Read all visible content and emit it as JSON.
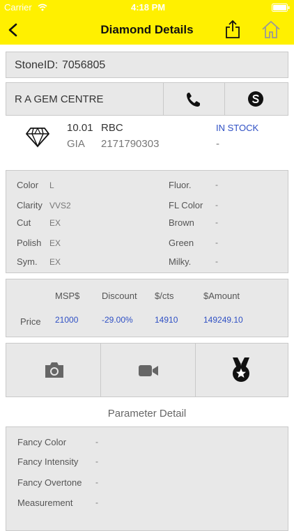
{
  "status_bar": {
    "carrier": "Carrier",
    "time": "4:18 PM"
  },
  "nav": {
    "title": "Diamond Details"
  },
  "stone": {
    "label": "StoneID:",
    "id": "7056805"
  },
  "dealer": {
    "name": "R A GEM CENTRE"
  },
  "summary": {
    "weight": "10.01",
    "shape": "RBC",
    "stock": "IN STOCK",
    "lab": "GIA",
    "cert": "2171790303",
    "extra": "-"
  },
  "attributes": {
    "left": [
      {
        "label": "Color",
        "value": "L"
      },
      {
        "label": "Clarity",
        "value": "VVS2"
      },
      {
        "label": "Cut",
        "value": "EX"
      },
      {
        "label": "Polish",
        "value": "EX"
      },
      {
        "label": "Sym.",
        "value": "EX"
      }
    ],
    "right": [
      {
        "label": "Fluor.",
        "value": "-"
      },
      {
        "label": "FL Color",
        "value": "-"
      },
      {
        "label": "Brown",
        "value": "-"
      },
      {
        "label": "Green",
        "value": "-"
      },
      {
        "label": "Milky.",
        "value": "-"
      }
    ]
  },
  "pricing": {
    "headers": [
      "MSP$",
      "Discount",
      "$/cts",
      "$Amount"
    ],
    "row_label": "Price",
    "values": [
      "21000",
      "-29.00%",
      "14910",
      "149249.10"
    ]
  },
  "section_title": "Parameter Detail",
  "parameters": [
    {
      "label": "Fancy Color",
      "value": "-"
    },
    {
      "label": "Fancy Intensity",
      "value": "-"
    },
    {
      "label": "Fancy Overtone",
      "value": "-"
    },
    {
      "label": "Measurement",
      "value": "-"
    }
  ],
  "colors": {
    "header": "#fff000",
    "panel": "#e8e8e8",
    "accent_blue": "#2e4fc4"
  }
}
